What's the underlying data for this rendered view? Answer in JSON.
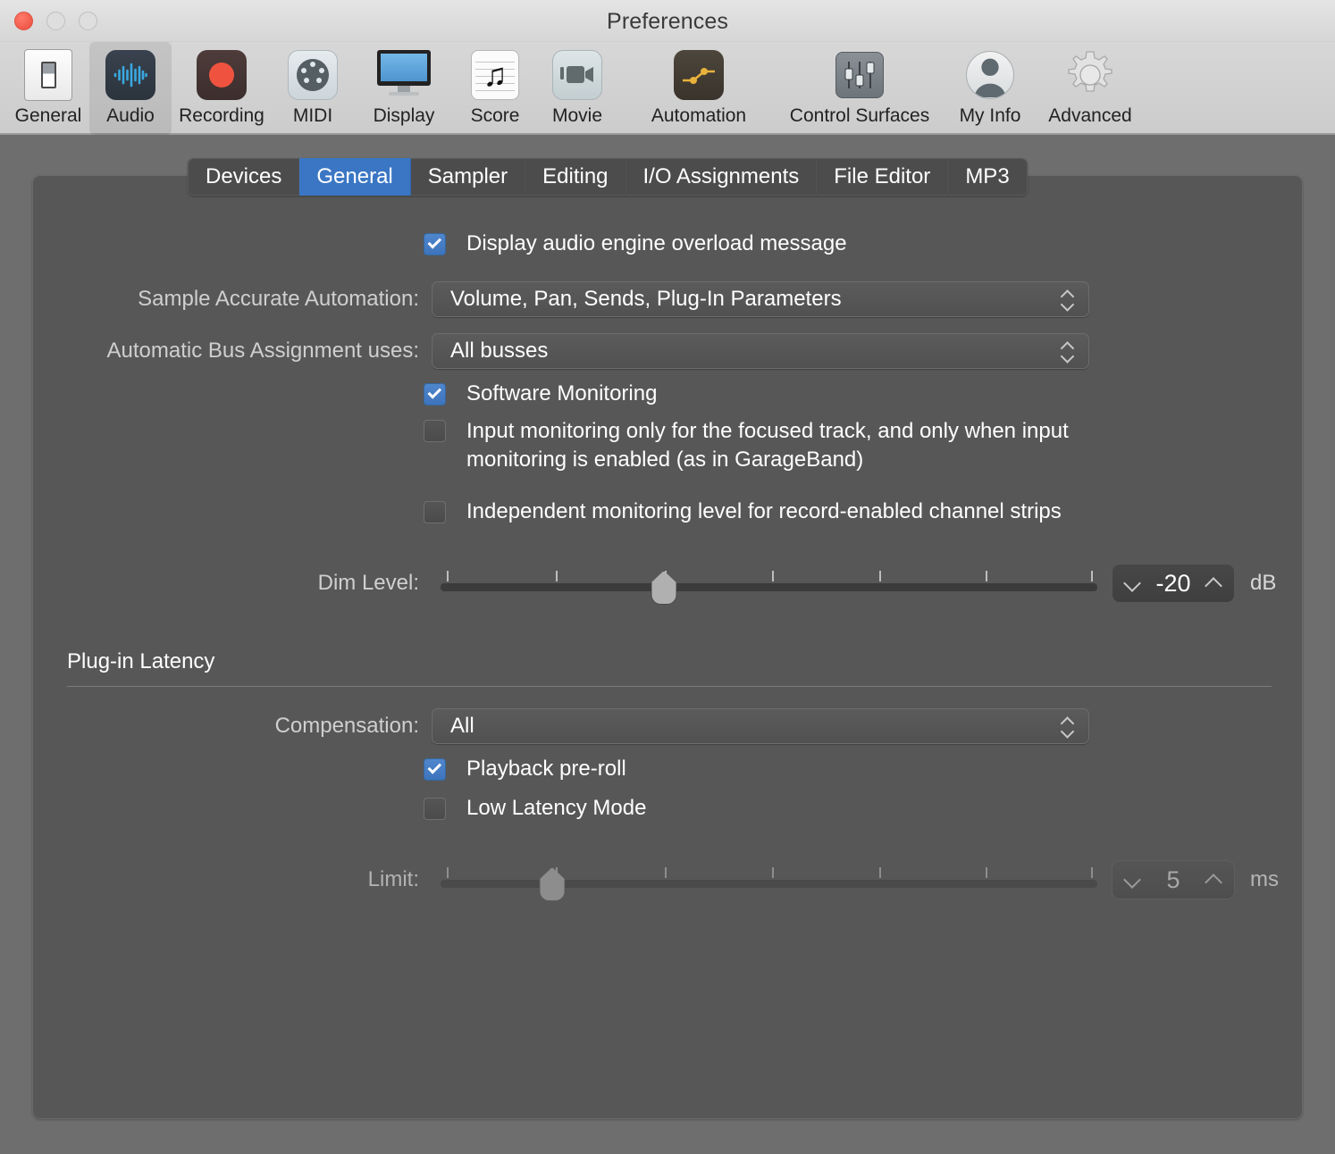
{
  "window": {
    "title": "Preferences",
    "traffic_lights": [
      "close",
      "minimize",
      "zoom"
    ]
  },
  "toolbar": {
    "items": [
      {
        "label": "General",
        "icon": "switch-icon",
        "selected": false
      },
      {
        "label": "Audio",
        "icon": "waveform-icon",
        "selected": true
      },
      {
        "label": "Recording",
        "icon": "record-dot-icon",
        "selected": false
      },
      {
        "label": "MIDI",
        "icon": "midi-port-icon",
        "selected": false
      },
      {
        "label": "Display",
        "icon": "monitor-icon",
        "selected": false
      },
      {
        "label": "Score",
        "icon": "music-note-icon",
        "selected": false
      },
      {
        "label": "Movie",
        "icon": "video-camera-icon",
        "selected": false
      },
      {
        "label": "Automation",
        "icon": "automation-curve-icon",
        "selected": false
      },
      {
        "label": "Control Surfaces",
        "icon": "faders-icon",
        "selected": false
      },
      {
        "label": "My Info",
        "icon": "person-icon",
        "selected": false
      },
      {
        "label": "Advanced",
        "icon": "gear-icon",
        "selected": false
      }
    ]
  },
  "tabs": [
    {
      "label": "Devices",
      "active": false
    },
    {
      "label": "General",
      "active": true
    },
    {
      "label": "Sampler",
      "active": false
    },
    {
      "label": "Editing",
      "active": false
    },
    {
      "label": "I/O Assignments",
      "active": false
    },
    {
      "label": "File Editor",
      "active": false
    },
    {
      "label": "MP3",
      "active": false
    }
  ],
  "general_pane": {
    "overload_checkbox": {
      "label": "Display audio engine overload message",
      "checked": true
    },
    "sample_accurate_automation": {
      "label": "Sample Accurate Automation:",
      "value": "Volume, Pan, Sends, Plug-In Parameters"
    },
    "automatic_bus_assignment": {
      "label": "Automatic Bus Assignment uses:",
      "value": "All busses"
    },
    "software_monitoring": {
      "label": "Software Monitoring",
      "checked": true
    },
    "input_monitoring_focused": {
      "line1": "Input monitoring only for the focused track, and only when input",
      "line2": "monitoring is enabled (as in GarageBand)",
      "checked": false
    },
    "independent_monitoring_level": {
      "label": "Independent monitoring level for record-enabled channel strips",
      "checked": false
    },
    "dim_level": {
      "label": "Dim Level:",
      "value": "-20",
      "unit": "dB",
      "thumb_percent": 34,
      "tick_count": 7,
      "enabled": true
    }
  },
  "plugin_latency": {
    "section_title": "Plug-in Latency",
    "compensation": {
      "label": "Compensation:",
      "value": "All"
    },
    "playback_preroll": {
      "label": "Playback pre-roll",
      "checked": true
    },
    "low_latency_mode": {
      "label": "Low Latency Mode",
      "checked": false
    },
    "limit": {
      "label": "Limit:",
      "value": "5",
      "unit": "ms",
      "thumb_percent": 17,
      "tick_count": 7,
      "enabled": false
    }
  },
  "colors": {
    "accent_blue": "#3a76c4",
    "checkbox_blue": "#4f86cc",
    "panel_bg": "#575757",
    "window_bg": "#6e6e6e",
    "titlebar_bg": "#d8d8d8",
    "close_red": "#f15a4a"
  }
}
